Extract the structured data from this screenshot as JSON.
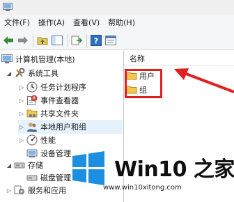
{
  "menubar": {
    "items": [
      "文件(F)",
      "操作(A)",
      "查看(V)",
      "帮助(H)"
    ]
  },
  "toolbar": {
    "buttons": [
      "back-icon",
      "forward-icon",
      "up-folder-icon",
      "show-tree-icon",
      "export-icon",
      "help-icon",
      "properties-icon"
    ]
  },
  "tree": {
    "root": "计算机管理(本地)",
    "system_tools": "系统工具",
    "task_scheduler": "任务计划程序",
    "event_viewer": "事件查看器",
    "shared_folders": "共享文件夹",
    "local_users": "本地用户和组",
    "performance": "性能",
    "device_manager": "设备管理",
    "storage": "存储",
    "disk_management": "磁盘管理",
    "services_apps": "服务和应用"
  },
  "list": {
    "column_name": "名称",
    "items": [
      "用户",
      "组"
    ]
  },
  "annotation": {
    "color": "#e02020"
  },
  "watermark": {
    "title": "Win10 之家",
    "url": "www.win10xitong.com",
    "logo_color": "#1e8ee0"
  }
}
